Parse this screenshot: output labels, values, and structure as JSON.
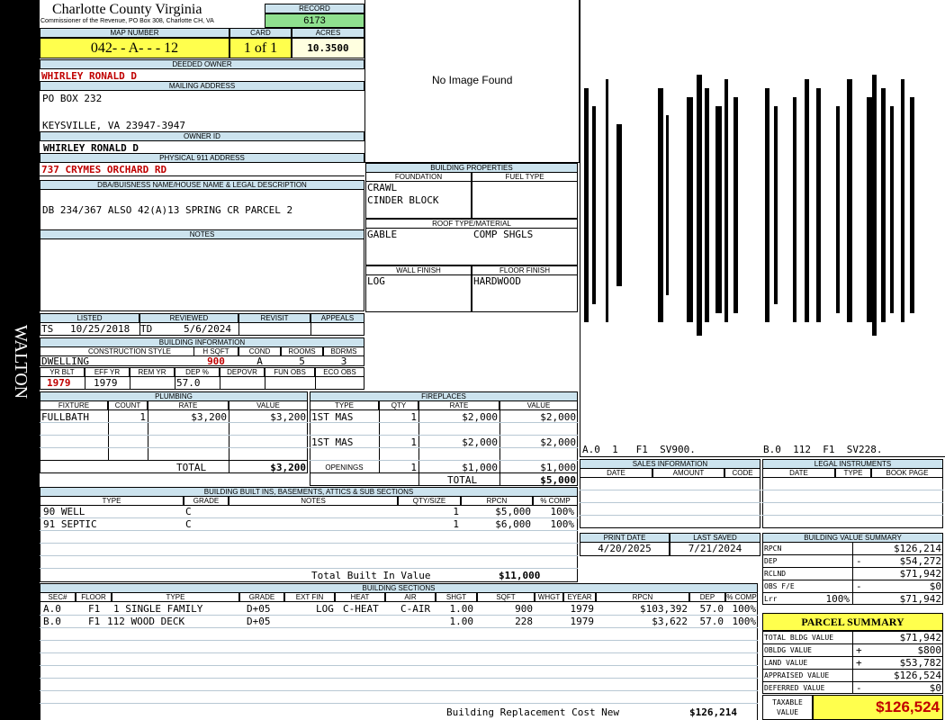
{
  "side_label": "WALTON",
  "header": {
    "county": "Charlotte County Virginia",
    "commissioner": "Commissioner of the Revenue, PO Box 308, Charlotte CH, VA",
    "record_label": "RECORD",
    "record": "6173",
    "map_label": "MAP NUMBER",
    "map_number": "042- - A- - - 12",
    "card_label": "CARD",
    "card": "1 of 1",
    "acres_label": "ACRES",
    "acres": "10.3500"
  },
  "owner": {
    "deeded_label": "DEEDED OWNER",
    "deeded_owner": "WHIRLEY RONALD D",
    "mailing_label": "MAILING ADDRESS",
    "mailing_line1": "PO BOX 232",
    "mailing_line2": "KEYSVILLE, VA 23947-3947",
    "owner_id_label": "OWNER ID",
    "owner_id": "WHIRLEY RONALD D",
    "physical_label": "PHYSICAL 911 ADDRESS",
    "physical_address": "737 CRYMES ORCHARD RD",
    "dba_label": "DBA/BUISNESS NAME/HOUSE NAME & LEGAL DESCRIPTION",
    "legal_description": "DB 234/367 ALSO 42(A)13 SPRING CR PARCEL 2",
    "notes_label": "NOTES"
  },
  "image": {
    "no_image": "No Image Found"
  },
  "sketch": {
    "labels": [
      "A.0  1   F1  SV900.",
      "B.0  112  F1  SV228."
    ]
  },
  "building_properties": {
    "title": "BUILDING PROPERTIES",
    "foundation_label": "FOUNDATION",
    "foundation": [
      "CRAWL",
      "CINDER BLOCK"
    ],
    "fuel_label": "FUEL TYPE",
    "roof_label": "ROOF TYPE/MATERIAL",
    "roof_type": "GABLE",
    "roof_material": "COMP SHGLS",
    "wall_label": "WALL FINISH",
    "wall": "LOG",
    "floor_label": "FLOOR FINISH",
    "floor": "HARDWOOD"
  },
  "review": {
    "listed_label": "LISTED",
    "listed_by": "TS",
    "listed_date": "10/25/2018",
    "reviewed_label": "REVIEWED",
    "reviewed_by": "TD",
    "reviewed_date": "5/6/2024",
    "revisit_label": "REVISIT",
    "appeals_label": "APPEALS"
  },
  "building_info": {
    "title": "BUILDING INFORMATION",
    "style_label": "CONSTRUCTION STYLE",
    "style": "DWELLING",
    "hsqft_label": "H SQFT",
    "hsqft": "900",
    "cond_label": "COND",
    "cond": "A",
    "rooms_label": "ROOMS",
    "rooms": "5",
    "bdrms_label": "BDRMS",
    "bdrms": "3",
    "yrblt_label": "YR BLT",
    "yrblt": "1979",
    "effyr_label": "EFF YR",
    "effyr": "1979",
    "remyr_label": "REM YR",
    "dep_label": "DEP %",
    "dep": "57.0",
    "depovr_label": "DEPOVR",
    "funobs_label": "FUN OBS",
    "ecoobs_label": "ECO OBS"
  },
  "plumbing": {
    "title": "PLUMBING",
    "headers": [
      "FIXTURE",
      "COUNT",
      "RATE",
      "VALUE"
    ],
    "rows": [
      {
        "fixture": "FULLBATH",
        "count": "1",
        "rate": "$3,200",
        "value": "$3,200"
      }
    ],
    "total_label": "TOTAL",
    "total": "$3,200"
  },
  "fireplaces": {
    "title": "FIREPLACES",
    "headers": [
      "TYPE",
      "QTY",
      "RATE",
      "VALUE"
    ],
    "rows": [
      {
        "type": "1ST MAS",
        "qty": "1",
        "rate": "$2,000",
        "value": "$2,000"
      },
      {
        "type": "1ST MAS",
        "qty": "1",
        "rate": "$2,000",
        "value": "$2,000"
      }
    ],
    "openings_label": "OPENINGS",
    "openings_qty": "1",
    "openings_rate": "$1,000",
    "openings_value": "$1,000",
    "total_label": "TOTAL",
    "total": "$5,000"
  },
  "built_ins": {
    "title": "BUILDING BUILT INS, BASEMENTS, ATTICS & SUB SECTIONS",
    "headers": [
      "TYPE",
      "GRADE",
      "NOTES",
      "QTY/SIZE",
      "RPCN",
      "% COMP"
    ],
    "rows": [
      {
        "type": "90 WELL",
        "grade": "C",
        "notes": "",
        "qty": "1",
        "rpcn": "$5,000",
        "comp": "100%"
      },
      {
        "type": "91 SEPTIC",
        "grade": "C",
        "notes": "",
        "qty": "1",
        "rpcn": "$6,000",
        "comp": "100%"
      }
    ],
    "total_label": "Total Built In Value",
    "total": "$11,000"
  },
  "sales": {
    "title": "SALES INFORMATION",
    "headers": [
      "DATE",
      "AMOUNT",
      "CODE"
    ]
  },
  "legal": {
    "title": "LEGAL INSTRUMENTS",
    "headers": [
      "DATE",
      "TYPE",
      "BOOK PAGE"
    ]
  },
  "dates": {
    "print_label": "PRINT DATE",
    "print_date": "4/20/2025",
    "saved_label": "LAST SAVED",
    "saved_date": "7/21/2024"
  },
  "value_summary": {
    "title": "BUILDING VALUE SUMMARY",
    "rows": [
      {
        "label": "RPCN",
        "sign": "",
        "value": "$126,214"
      },
      {
        "label": "DEP",
        "sign": "-",
        "value": "$54,272"
      },
      {
        "label": "RCLND",
        "sign": "",
        "value": "$71,942"
      },
      {
        "label": "OBS F/E",
        "sign": "-",
        "value": "$0"
      },
      {
        "label": "Lrr",
        "pct": "100%",
        "sign": "",
        "value": "$71,942"
      }
    ]
  },
  "parcel_summary": {
    "title": "PARCEL SUMMARY",
    "rows": [
      {
        "label": "TOTAL BLDG VALUE",
        "sign": "",
        "value": "$71,942"
      },
      {
        "label": "OBLDG VALUE",
        "sign": "+",
        "value": "$800"
      },
      {
        "label": "LAND VALUE",
        "sign": "+",
        "value": "$53,782"
      },
      {
        "label": "APPRAISED VALUE",
        "sign": "",
        "value": "$126,524"
      },
      {
        "label": "DEFERRED VALUE",
        "sign": "-",
        "value": "$0"
      }
    ],
    "taxable_label_1": "TAXABLE",
    "taxable_label_2": "VALUE",
    "taxable": "$126,524"
  },
  "sections": {
    "title": "BUILDING SECTIONS",
    "headers": [
      "SEC#",
      "FLOOR",
      "TYPE",
      "GRADE",
      "EXT FIN",
      "HEAT",
      "AIR",
      "SHGT",
      "SQFT",
      "WHGT",
      "EYEAR",
      "RPCN",
      "DEP",
      "% COMP"
    ],
    "rows": [
      {
        "sec": "A.0",
        "floor": "F1",
        "type": "1 SINGLE FAMILY",
        "grade": "D+05",
        "ext": "LOG",
        "heat": "C-HEAT",
        "air": "C-AIR",
        "shgt": "1.00",
        "sqft": "900",
        "whgt": "",
        "eyear": "1979",
        "rpcn": "$103,392",
        "dep": "57.0",
        "comp": "100%"
      },
      {
        "sec": "B.0",
        "floor": "F1",
        "type": "112 WOOD DECK",
        "grade": "D+05",
        "ext": "",
        "heat": "",
        "air": "",
        "shgt": "1.00",
        "sqft": "228",
        "whgt": "",
        "eyear": "1979",
        "rpcn": "$3,622",
        "dep": "57.0",
        "comp": "100%"
      }
    ],
    "replacement_label": "Building Replacement Cost New",
    "replacement": "$126,214"
  }
}
